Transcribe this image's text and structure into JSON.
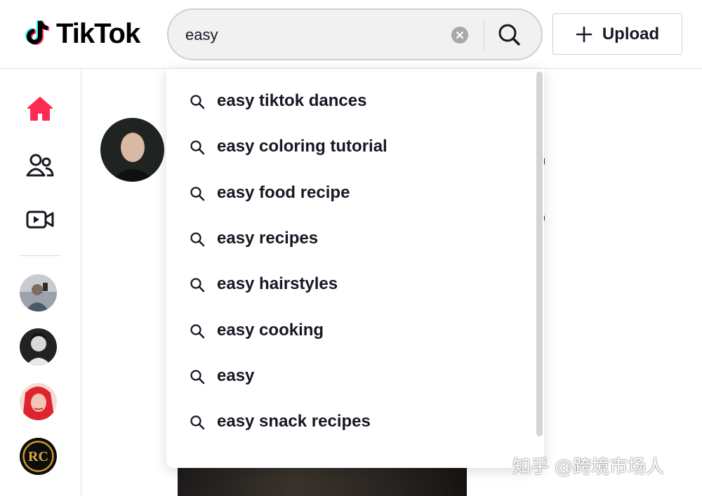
{
  "brand": {
    "name": "TikTok"
  },
  "search": {
    "query": "easy",
    "clear_label": "clear search",
    "submit_label": "search"
  },
  "header": {
    "upload_label": "Upload"
  },
  "sidebar": {
    "nav": [
      {
        "name": "home",
        "icon": "home-icon",
        "active": true
      },
      {
        "name": "following",
        "icon": "people-icon"
      },
      {
        "name": "live",
        "icon": "live-video-icon"
      }
    ],
    "suggested_accounts": [
      {
        "name": "account-1"
      },
      {
        "name": "account-2"
      },
      {
        "name": "account-3"
      },
      {
        "name": "account-4",
        "badge_text": "RC"
      }
    ]
  },
  "suggestions": [
    "easy tiktok dances",
    "easy coloring tutorial",
    "easy food recipe",
    "easy recipes",
    "easy hairstyles",
    "easy cooking",
    "easy",
    "easy snack recipes"
  ],
  "watermark": {
    "text": "知乎 @跨境市场人"
  },
  "colors": {
    "accent": "#fe2c55",
    "text": "#161823",
    "search_bg": "#f1f1f2"
  }
}
